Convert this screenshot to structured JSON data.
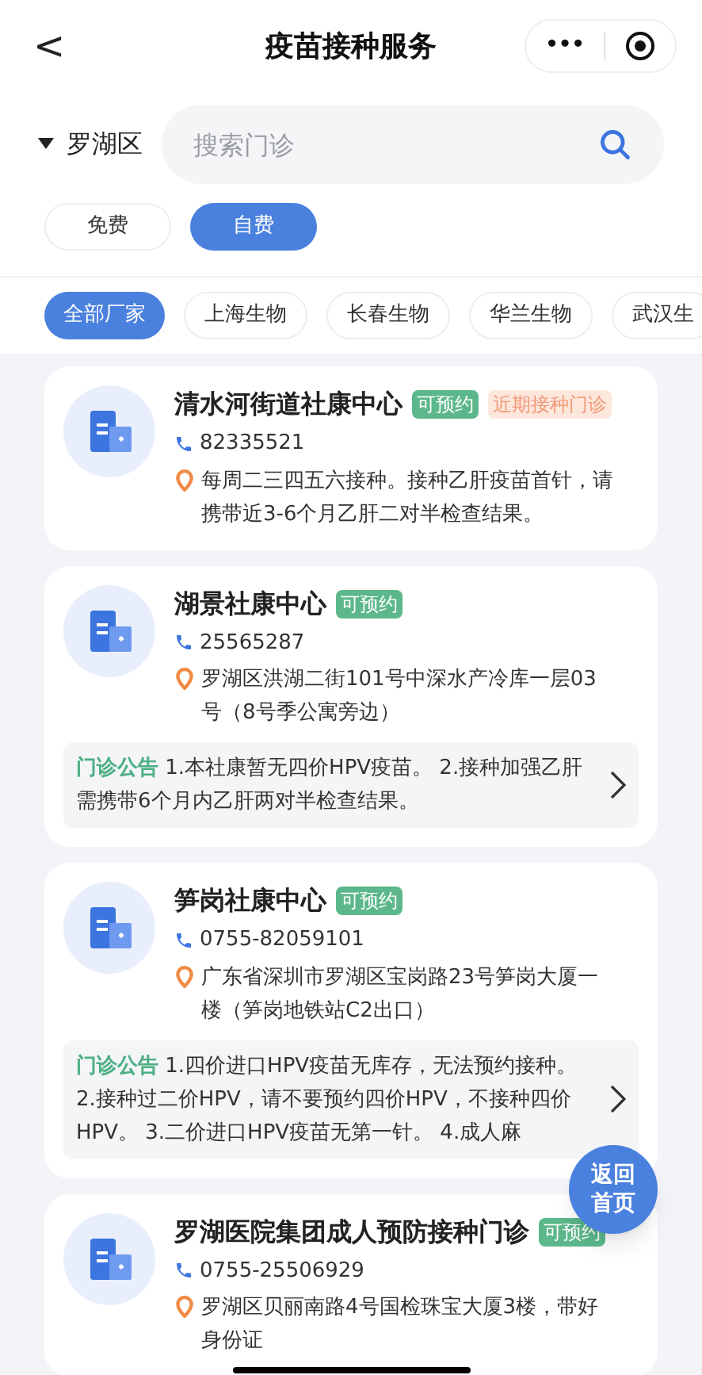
{
  "header": {
    "back": "<",
    "title": "疫苗接种服务",
    "more": "•••"
  },
  "district": {
    "label": "罗湖区"
  },
  "search": {
    "placeholder": "搜索门诊"
  },
  "fee_tabs": [
    {
      "label": "免费",
      "selected": false
    },
    {
      "label": "自费",
      "selected": true
    }
  ],
  "makers": [
    {
      "label": "全部厂家",
      "selected": true
    },
    {
      "label": "上海生物",
      "selected": false
    },
    {
      "label": "长春生物",
      "selected": false
    },
    {
      "label": "华兰生物",
      "selected": false
    },
    {
      "label": "武汉生",
      "selected": false
    }
  ],
  "clinics": [
    {
      "name": "清水河街道社康中心",
      "tags": [
        {
          "label": "可预约",
          "kind": "bookable"
        },
        {
          "label": "近期接种门诊",
          "kind": "recent"
        }
      ],
      "phone": "82335521",
      "address": "每周二三四五六接种。接种乙肝疫苗首针，请携带近3-6个月乙肝二对半检查结果。"
    },
    {
      "name": "湖景社康中心",
      "tags": [
        {
          "label": "可预约",
          "kind": "bookable"
        }
      ],
      "phone": "25565287",
      "address": "罗湖区洪湖二街101号中深水产冷库一层03号（8号季公寓旁边）",
      "notice": {
        "label": "门诊公告",
        "text": "1.本社康暂无四价HPV疫苗。 2.接种加强乙肝需携带6个月内乙肝两对半检查结果。"
      }
    },
    {
      "name": "笋岗社康中心",
      "tags": [
        {
          "label": "可预约",
          "kind": "bookable"
        }
      ],
      "phone": "0755-82059101",
      "address": "广东省深圳市罗湖区宝岗路23号笋岗大厦一楼（笋岗地铁站C2出口）",
      "notice": {
        "label": "门诊公告",
        "text": "1.四价进口HPV疫苗无库存，无法预约接种。 2.接种过二价HPV，请不要预约四价HPV，不接种四价HPV。 3.二价进口HPV疫苗无第一针。 4.成人麻"
      }
    },
    {
      "name": "罗湖医院集团成人预防接种门诊",
      "tags": [
        {
          "label": "可预约",
          "kind": "bookable"
        }
      ],
      "phone": "0755-25506929",
      "address": "罗湖区贝丽南路4号国检珠宝大厦3楼，带好身份证"
    }
  ],
  "float_button": {
    "label": "返回首页"
  }
}
